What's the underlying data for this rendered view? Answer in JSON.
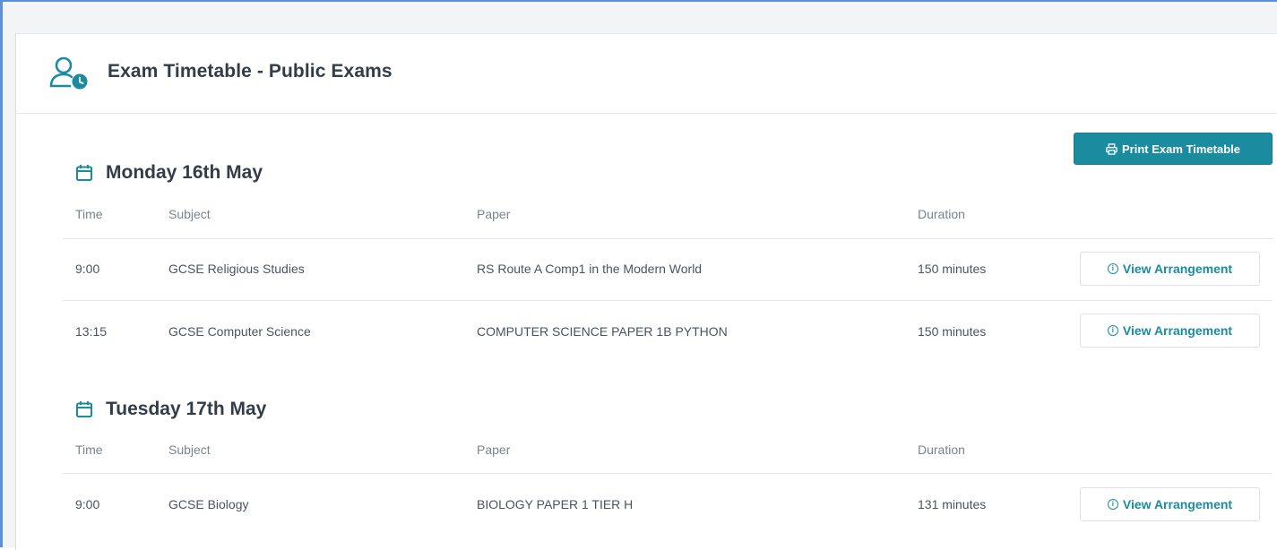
{
  "page": {
    "title": "Exam Timetable - Public Exams"
  },
  "toolbar": {
    "print_label": "Print Exam Timetable"
  },
  "columns": {
    "time": "Time",
    "subject": "Subject",
    "paper": "Paper",
    "duration": "Duration"
  },
  "days": [
    {
      "title": "Monday 16th May",
      "rows": [
        {
          "time": "9:00",
          "subject": "GCSE Religious Studies",
          "paper": "RS Route A Comp1 in the Modern World",
          "duration": "150 minutes",
          "action": "View Arrangement"
        },
        {
          "time": "13:15",
          "subject": "GCSE Computer Science",
          "paper": "COMPUTER SCIENCE PAPER 1B PYTHON",
          "duration": "150 minutes",
          "action": "View Arrangement"
        }
      ]
    },
    {
      "title": "Tuesday 17th May",
      "rows": [
        {
          "time": "9:00",
          "subject": "GCSE Biology",
          "paper": "BIOLOGY PAPER 1 TIER H",
          "duration": "131 minutes",
          "action": "View Arrangement"
        }
      ]
    }
  ],
  "colors": {
    "accent": "#1b8ba0",
    "frame_border": "#5b8fd6",
    "heading_text": "#333d47"
  },
  "icons": {
    "header": "user-clock-icon",
    "print": "printer-icon",
    "day": "calendar-icon",
    "action": "info-icon"
  }
}
